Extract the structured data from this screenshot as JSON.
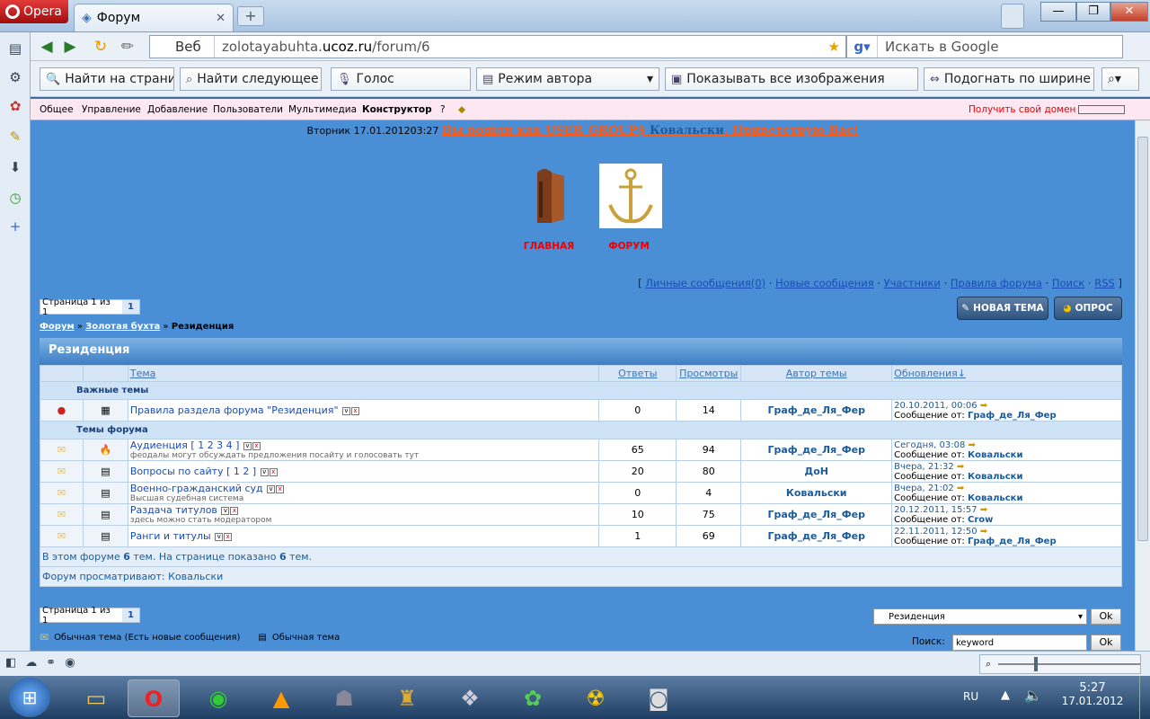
{
  "browser": {
    "menu_label": "Opera",
    "tab_title": "Форум",
    "addr_prefix": "Веб",
    "url_pre": "zolotayabuhta.",
    "url_host": "ucoz.ru",
    "url_path": "/forum/6",
    "search_placeholder": "Искать в Google"
  },
  "toolbar": {
    "find_placeholder": "Найти на страниц",
    "find_next": "Найти следующее",
    "voice": "Голос",
    "author_mode": "Режим автора",
    "show_images": "Показывать все изображения",
    "fit_width": "Подогнать по ширине"
  },
  "ucoz": {
    "menu": [
      "Общее",
      "Управление",
      "Добавление",
      "Пользователи",
      "Мультимедиа",
      "Конструктор",
      "?"
    ],
    "domain": "Получить свой домен"
  },
  "page": {
    "datetime": "Вторник 17.01.201203:27",
    "welcome_a": "Вы вошли как USER_GROUP$",
    "welcome_user": "Ковальски",
    "welcome_b": ". Приветствую Вас!",
    "nav_home": "ГЛАВНАЯ",
    "nav_forum": "ФОРУМ",
    "links": [
      "Личные сообщения(0)",
      "Новые сообщения",
      "Участники",
      "Правила форума",
      "Поиск",
      "RSS"
    ],
    "pager_text": "Страница 1 из 1",
    "pager_cur": "1",
    "btn_new_topic": "НОВАЯ ТЕМА",
    "btn_poll": "ОПРОС",
    "crumbs": [
      "Форум",
      "Золотая бухта",
      "Резиденция"
    ],
    "forum_title": "Резиденция",
    "cols": {
      "topic": "Тема",
      "replies": "Ответы",
      "views": "Просмотры",
      "author": "Автор темы",
      "updates": "Обновления"
    },
    "sec_important": "Важные темы",
    "sec_topics": "Темы форума",
    "posted_by": "Сообщение от:",
    "topics": [
      {
        "title": "Правила раздела форума \"Резиденция\"",
        "pages": "",
        "desc": "",
        "replies": "0",
        "views": "14",
        "author": "Граф_де_Ля_Фер",
        "date": "20.10.2011, 00:06",
        "by": "Граф_де_Ля_Фер"
      },
      {
        "title": "Аудиенция",
        "pages": "[ 1 2 3 4 ]",
        "desc": "феодалы могут обсуждать предложения посайту и голосовать тут",
        "replies": "65",
        "views": "94",
        "author": "Граф_де_Ля_Фер",
        "date": "Сегодня, 03:08",
        "by": "Ковальски"
      },
      {
        "title": "Вопросы по сайту",
        "pages": "[ 1 2 ]",
        "desc": "",
        "replies": "20",
        "views": "80",
        "author": "ДоН",
        "date": "Вчера, 21:32",
        "by": "Ковальски"
      },
      {
        "title": "Военно-гражданский суд",
        "pages": "",
        "desc": "Высшая судебная система",
        "replies": "0",
        "views": "4",
        "author": "Ковальски",
        "date": "Вчера, 21:02",
        "by": "Ковальски"
      },
      {
        "title": "Раздача титулов",
        "pages": "",
        "desc": "здесь можно стать модератором",
        "replies": "10",
        "views": "75",
        "author": "Граф_де_Ля_Фер",
        "date": "20.12.2011, 15:57",
        "by": "Crow"
      },
      {
        "title": "Ранги и титулы",
        "pages": "",
        "desc": "",
        "replies": "1",
        "views": "69",
        "author": "Граф_де_Ля_Фер",
        "date": "22.11.2011, 12:50",
        "by": "Граф_де_Ля_Фер"
      }
    ],
    "stats_a": "В этом форуме",
    "stats_n1": "6",
    "stats_b": "тем. На странице показано",
    "stats_n2": "6",
    "stats_c": "тем.",
    "viewing": "Форум просматривают: Ковальски",
    "jump_value": "Резиденция",
    "ok": "Ok",
    "legend_new": "Обычная тема (Есть новые сообщения)",
    "legend_normal": "Обычная тема",
    "search_label": "Поиск:",
    "search_value": "keyword"
  },
  "taskbar": {
    "lang": "RU",
    "time": "5:27",
    "date": "17.01.2012"
  }
}
